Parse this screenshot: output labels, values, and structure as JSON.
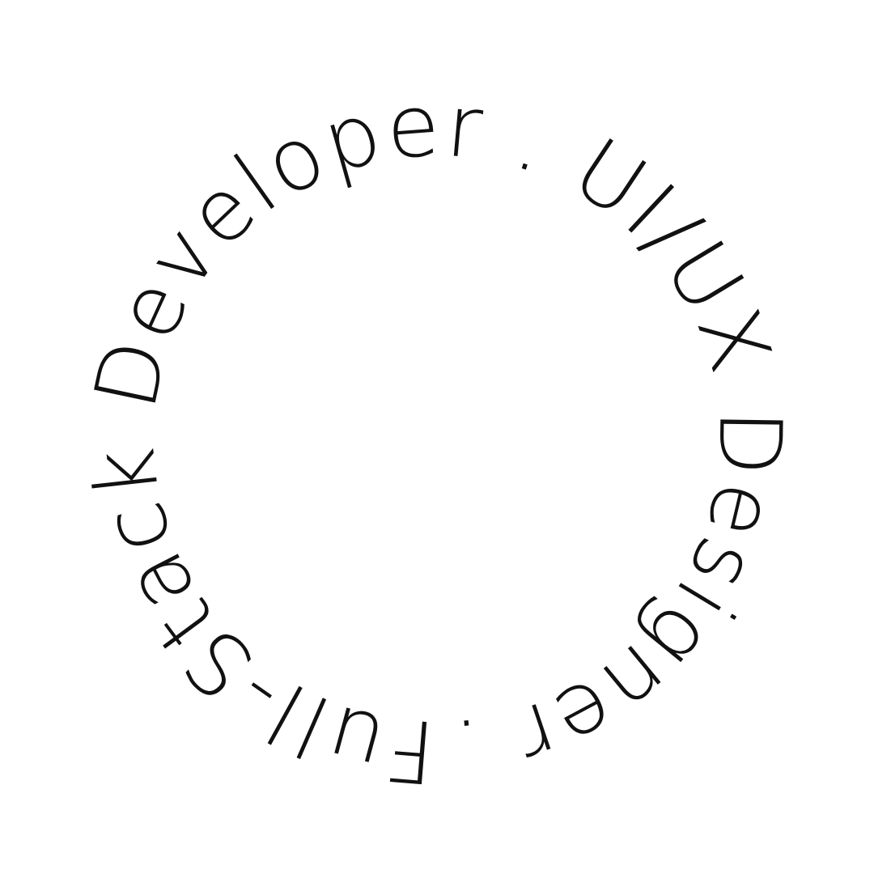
{
  "ring_text": "Full-Stack Developer . UI/UX Designer . ",
  "colors": {
    "background": "#ffffff",
    "text": "#111111"
  }
}
